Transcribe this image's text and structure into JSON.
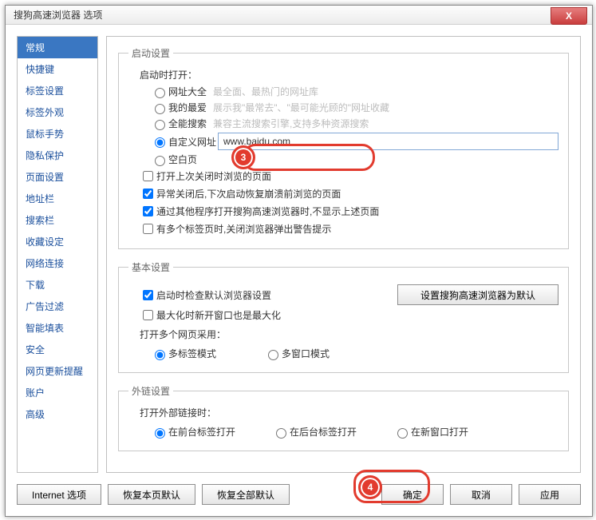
{
  "window": {
    "title": "搜狗高速浏览器 选项",
    "close": "X"
  },
  "sidebar": {
    "items": [
      "常规",
      "快捷键",
      "标签设置",
      "标签外观",
      "鼠标手势",
      "隐私保护",
      "页面设置",
      "地址栏",
      "搜索栏",
      "收藏设定",
      "网络连接",
      "下载",
      "广告过滤",
      "智能填表",
      "安全",
      "网页更新提醒",
      "账户",
      "高级"
    ],
    "active": 0
  },
  "startup": {
    "legend": "启动设置",
    "openLabel": "启动时打开：",
    "radios": {
      "all": "网址大全",
      "fav": "我的最爱",
      "search": "全能搜索",
      "custom": "自定义网址",
      "blank": "空白页"
    },
    "hints": {
      "all": "最全面、最热门的网址库",
      "fav": "展示我\"最常去\"、\"最可能光顾的\"网址收藏",
      "search": "兼容主流搜索引擎,支持多种资源搜索"
    },
    "customUrl": "www.baidu.com",
    "cb1": "打开上次关闭时浏览的页面",
    "cb2": "异常关闭后,下次启动恢复崩溃前浏览的页面",
    "cb3": "通过其他程序打开搜狗高速浏览器时,不显示上述页面",
    "cb4": "有多个标签页时,关闭浏览器弹出警告提示"
  },
  "basic": {
    "legend": "基本设置",
    "cbDefault": "启动时检查默认浏览器设置",
    "btnDefault": "设置搜狗高速浏览器为默认",
    "cbMax": "最大化时新开窗口也是最大化",
    "multiLabel": "打开多个网页采用：",
    "rTab": "多标签模式",
    "rWin": "多窗口模式"
  },
  "ext": {
    "legend": "外链设置",
    "label": "打开外部链接时：",
    "rFront": "在前台标签打开",
    "rBack": "在后台标签打开",
    "rNew": "在新窗口打开"
  },
  "bottom": {
    "ie": "Internet 选项",
    "resetPage": "恢复本页默认",
    "resetAll": "恢复全部默认",
    "ok": "确定",
    "cancel": "取消",
    "apply": "应用"
  },
  "annot": {
    "n3": "3",
    "n4": "4"
  }
}
